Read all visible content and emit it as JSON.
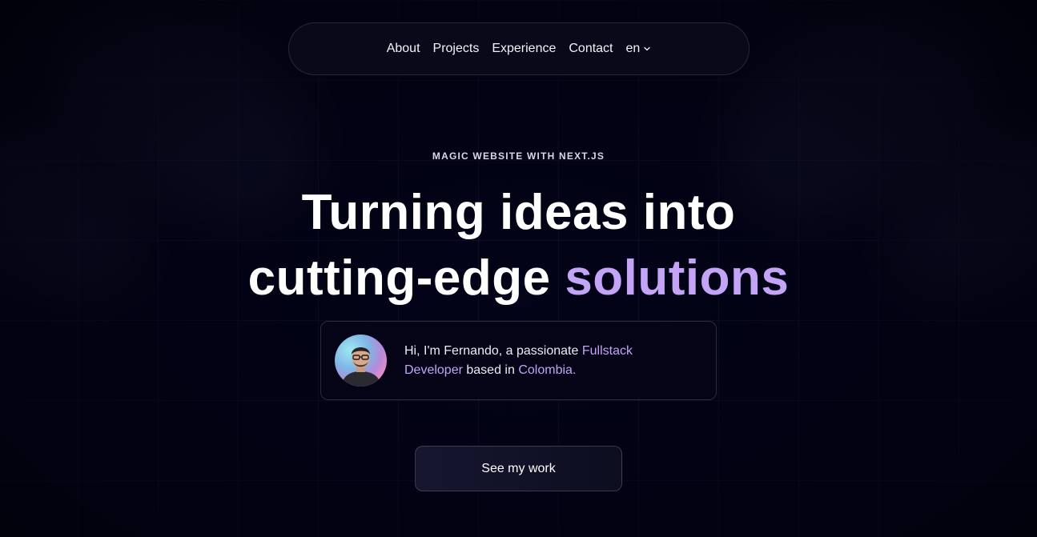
{
  "nav": {
    "items": [
      "About",
      "Projects",
      "Experience",
      "Contact"
    ],
    "language": "en"
  },
  "hero": {
    "eyebrow": "MAGIC WEBSITE WITH NEXT.JS",
    "line1": "Turning ideas into",
    "line2_prefix": "cutting-edge ",
    "line2_accent": "solutions"
  },
  "intro": {
    "avatar_icon": "profile-photo",
    "text_prefix": "Hi, I'm Fernando, a passionate ",
    "role": "Fullstack Developer",
    "text_middle": " based in ",
    "location": "Colombia."
  },
  "cta": {
    "label": "See my work"
  },
  "colors": {
    "background": "#03031a",
    "accent": "#c3a4f7",
    "text": "#ffffff"
  }
}
